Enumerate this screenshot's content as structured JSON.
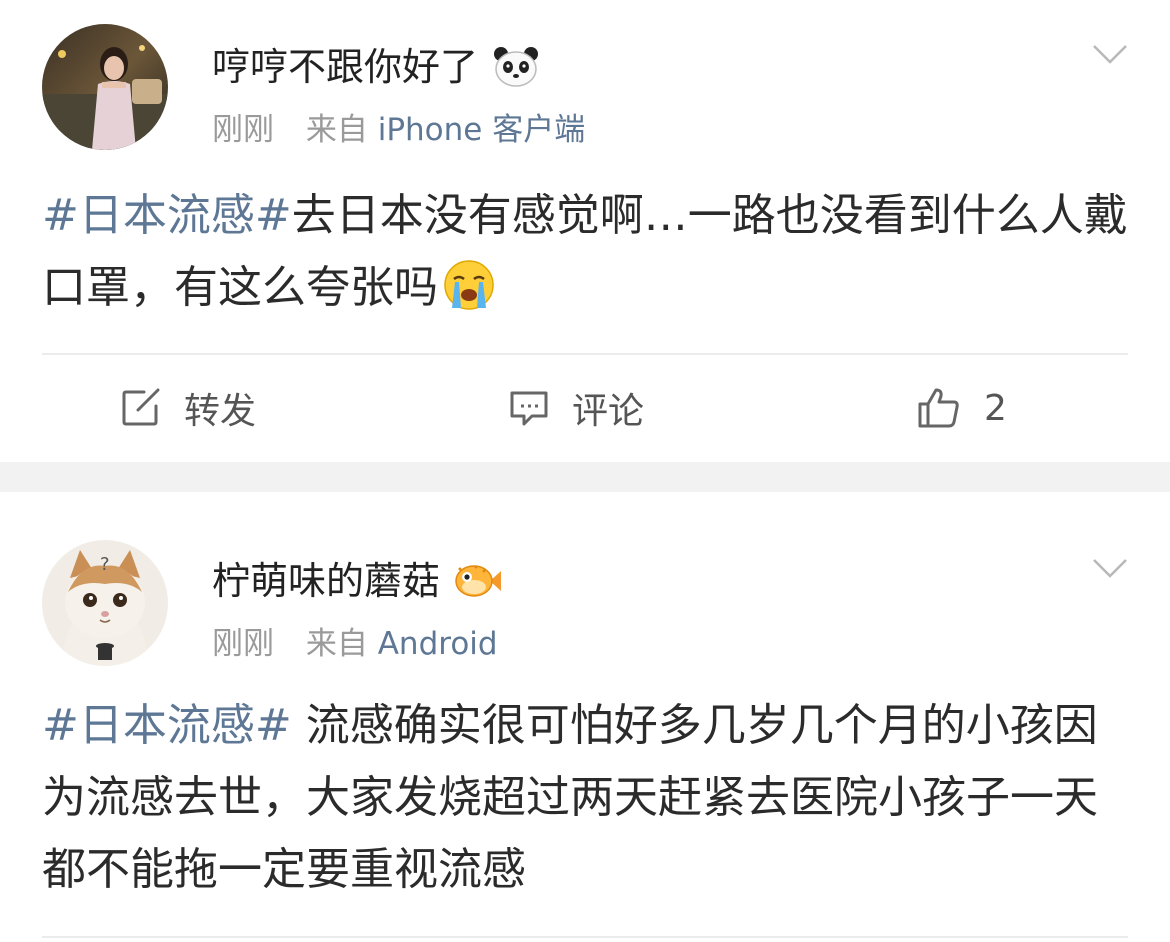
{
  "posts": [
    {
      "username": "哼哼不跟你好了",
      "badge_icon": "panda-icon",
      "time": "刚刚",
      "from_prefix": "来自",
      "client": "iPhone 客户端",
      "topic": "#日本流感#",
      "text": "去日本没有感觉啊…一路也没看到什么人戴口罩，有这么夸张吗",
      "emoji_icon": "crying-face-icon",
      "actions": {
        "repost_label": "转发",
        "comment_label": "评论",
        "like_count": "2"
      }
    },
    {
      "username": "柠萌味的蘑菇",
      "badge_icon": "pufferfish-icon",
      "time": "刚刚",
      "from_prefix": "来自",
      "client": "Android",
      "topic": "#日本流感#",
      "text": " 流感确实很可怕好多几岁几个月的小孩因为流感去世，大家发烧超过两天赶紧去医院小孩子一天都不能拖一定要重视流感"
    }
  ],
  "colors": {
    "link": "#5d7795",
    "meta": "#9a9a9a",
    "separator": "#f2f2f2"
  }
}
